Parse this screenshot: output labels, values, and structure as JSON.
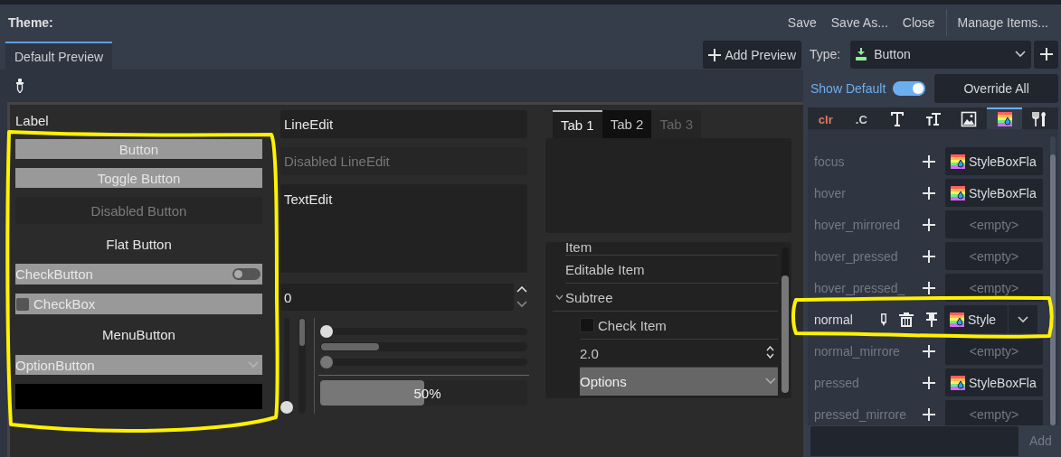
{
  "window": {
    "title": "Theme:"
  },
  "header_actions": [
    {
      "label": "Save",
      "separator_before": false
    },
    {
      "label": "Save As...",
      "separator_before": false
    },
    {
      "label": "Close",
      "separator_before": false
    },
    {
      "label": "Manage Items...",
      "separator_before": true
    }
  ],
  "preview_tabs": [
    {
      "label": "Default Preview",
      "selected": true
    }
  ],
  "add_preview": {
    "label": "Add Preview"
  },
  "type_selector": {
    "label": "Type:",
    "value": "Button"
  },
  "show_default": {
    "label": "Show Default",
    "on": true
  },
  "override_all": {
    "label": "Override All"
  },
  "item_type_tabs": [
    {
      "kind": "color",
      "glyph": "clr",
      "selected": false
    },
    {
      "kind": "constant",
      "glyph": ".C",
      "selected": false
    },
    {
      "kind": "font",
      "selected": false
    },
    {
      "kind": "font_size",
      "selected": false
    },
    {
      "kind": "icon",
      "selected": false
    },
    {
      "kind": "stylebox",
      "selected": true
    },
    {
      "kind": "type",
      "selected": false
    }
  ],
  "style_items": [
    {
      "name": "focus",
      "overridden": false,
      "value": "StyleBoxFla",
      "has_resource": true
    },
    {
      "name": "hover",
      "overridden": false,
      "value": "StyleBoxFla",
      "has_resource": true
    },
    {
      "name": "hover_mirrored",
      "overridden": false,
      "value": "<empty>",
      "has_resource": false
    },
    {
      "name": "hover_pressed",
      "overridden": false,
      "value": "<empty>",
      "has_resource": false
    },
    {
      "name": "hover_pressed_",
      "overridden": false,
      "value": "<empty>",
      "has_resource": false
    },
    {
      "name": "normal",
      "overridden": true,
      "value": "Style",
      "has_resource": true
    },
    {
      "name": "normal_mirrore",
      "overridden": false,
      "value": "<empty>",
      "has_resource": false
    },
    {
      "name": "pressed",
      "overridden": false,
      "value": "StyleBoxFla",
      "has_resource": true
    },
    {
      "name": "pressed_mirrore",
      "overridden": false,
      "value": "<empty>",
      "has_resource": false
    }
  ],
  "add_item": {
    "button": "Add"
  },
  "preview": {
    "controls": [
      {
        "kind": "label",
        "text": "Label"
      },
      {
        "kind": "button",
        "text": "Button",
        "disabled": false
      },
      {
        "kind": "button",
        "text": "Toggle Button",
        "disabled": false
      },
      {
        "kind": "button",
        "text": "Disabled Button",
        "disabled": true
      },
      {
        "kind": "flat_button",
        "text": "Flat Button"
      },
      {
        "kind": "check_button",
        "text": "CheckButton",
        "on": false
      },
      {
        "kind": "checkbox",
        "text": "CheckBox",
        "checked": false
      },
      {
        "kind": "menu_button",
        "text": "MenuButton"
      },
      {
        "kind": "option_button",
        "text": "OptionButton"
      },
      {
        "kind": "color_button",
        "color": "#000000"
      }
    ],
    "line_edits": [
      {
        "value": "LineEdit",
        "disabled": false
      },
      {
        "value": "Disabled LineEdit",
        "disabled": true
      }
    ],
    "text_edit": {
      "value": "TextEdit"
    },
    "spin_box": {
      "value": "0"
    },
    "v_slider": {
      "level": 0
    },
    "h_sliders": [
      {
        "level": 0
      },
      {
        "level": 0
      }
    ],
    "progress": {
      "level": 0.5,
      "reading": "50%"
    },
    "tabs": [
      {
        "label": "Tab 1",
        "selected": true,
        "disabled": false
      },
      {
        "label": "Tab 2",
        "selected": false,
        "disabled": false
      },
      {
        "label": "Tab 3",
        "selected": false,
        "disabled": true
      }
    ],
    "tree": [
      {
        "kind": "text",
        "label": "Item"
      },
      {
        "kind": "text",
        "label": "Editable Item"
      },
      {
        "kind": "text",
        "label": "Subtree",
        "expanded": true,
        "children": [
          {
            "kind": "check",
            "label": "Check Item",
            "checked": false
          },
          {
            "kind": "range",
            "value": "2.0"
          },
          {
            "kind": "option",
            "value": "Options"
          }
        ]
      }
    ]
  },
  "highlights": [
    {
      "kind": "freehand"
    },
    {
      "kind": "freehand"
    }
  ]
}
